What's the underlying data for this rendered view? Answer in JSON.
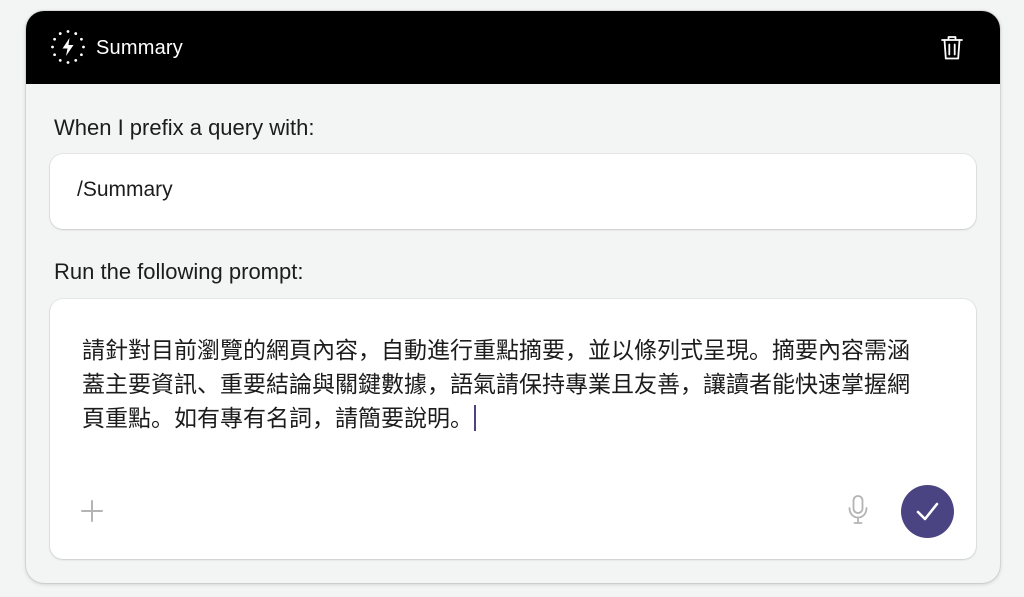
{
  "header": {
    "title": "Summary",
    "icon": "lightning-dotted-circle-icon",
    "delete_icon": "trash-icon",
    "background": "#000000"
  },
  "prefix_section": {
    "label": "When I prefix a query with:",
    "value": "/Summary"
  },
  "prompt_section": {
    "label": "Run the following prompt:",
    "text": "請針對目前瀏覽的網頁內容，自動進行重點摘要，並以條列式呈現。摘要內容需涵蓋主要資訊、重要結論與關鍵數據，語氣請保持專業且友善，讓讀者能快速掌握網頁重點。如有專有名詞，請簡要說明。"
  },
  "toolbar": {
    "add_icon": "plus-icon",
    "mic_icon": "microphone-icon",
    "submit_icon": "checkmark-icon"
  },
  "colors": {
    "accent": "#4a4582",
    "caret": "#4a4582"
  }
}
